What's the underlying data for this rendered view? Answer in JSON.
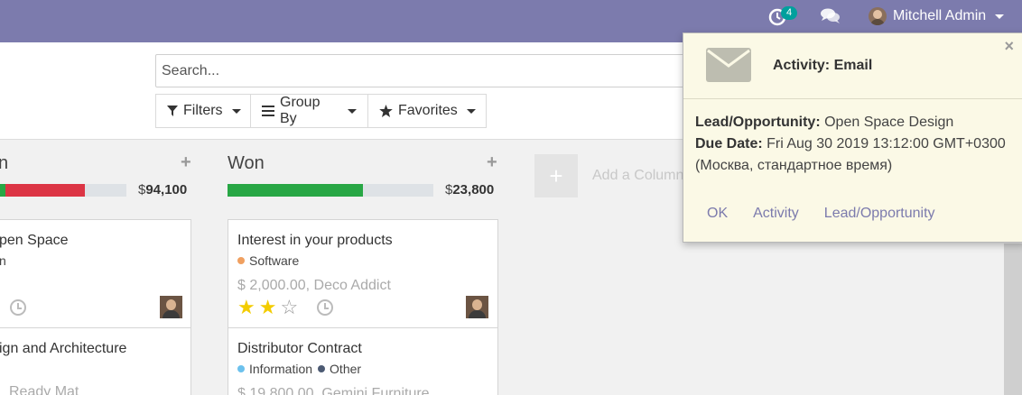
{
  "navbar": {
    "activity_count": "4",
    "user_name": "Mitchell Admin",
    "bg_color": "#7c7bad"
  },
  "control_panel": {
    "search_placeholder": "Search...",
    "filters_label": "Filters",
    "group_by_label": "Group By",
    "favorites_label": "Favorites"
  },
  "kanban": {
    "columns": [
      {
        "title": "n",
        "total_currency": "$",
        "total_value": "94,100",
        "progress": [
          {
            "color": "#28a745",
            "fraction": 0.04
          },
          {
            "color": "#dc3545",
            "fraction": 0.66
          }
        ],
        "cards": [
          {
            "title": "pen Space",
            "tag_fragment": "n",
            "stars": 0
          },
          {
            "title": "ign and Architecture",
            "subtitle": "Ready Mat"
          }
        ]
      },
      {
        "title": "Won",
        "total_currency": "$",
        "total_value": "23,800",
        "progress": [
          {
            "color": "#28a745",
            "fraction": 0.66
          }
        ],
        "cards": [
          {
            "title": "Interest in your products",
            "tags": [
              {
                "label": "Software",
                "color": "#f0a060"
              }
            ],
            "subtitle": "$ 2,000.00, Deco Addict",
            "stars": 2,
            "max_stars": 3
          },
          {
            "title": "Distributor Contract",
            "tags": [
              {
                "label": "Information",
                "color": "#6cc1ed"
              },
              {
                "label": "Other",
                "color": "#4c5a73"
              }
            ],
            "subtitle": "$ 19,800.00, Gemini Furniture"
          }
        ]
      }
    ],
    "add_column_label": "Add a Column"
  },
  "popover": {
    "title": "Activity: Email",
    "lead_label": "Lead/Opportunity:",
    "lead_value": "Open Space Design",
    "due_label": "Due Date:",
    "due_value": "Fri Aug 30 2019 13:12:00 GMT+0300",
    "due_tz": "(Москва, стандартное время)",
    "actions": [
      "OK",
      "Activity",
      "Lead/Opportunity"
    ],
    "close_symbol": "×"
  }
}
